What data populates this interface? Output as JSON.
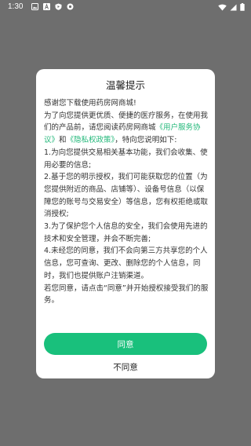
{
  "status_bar": {
    "time": "1:30",
    "left_icons": [
      "image-icon",
      "font-icon",
      "play-protect-icon",
      "shield-icon"
    ],
    "right_icons": [
      "wifi-icon",
      "signal-icon",
      "battery-icon"
    ]
  },
  "dialog": {
    "title": "温馨提示",
    "greeting": "感谢您下载使用药房网商城!",
    "intro_part1": "为了向您提供更优质、便捷的医疗服务，在使用我们的产品前，请您阅读药房网商城",
    "user_agreement_link": "《用户服务协议》",
    "and": "和",
    "privacy_policy_link": "《隐私权政策》",
    "intro_part2": "，特向您说明如下:",
    "item1": "1.为向您提供交易相关基本功能，我们会收集、使用必要的信息;",
    "item2": "2.基于您的明示授权，我们可能获取您的位置（为您提供附近的商品、店铺等）、设备号信息（以保障您的账号与交易安全）等信息，您有权拒绝或取消授权;",
    "item3": "3.为了保护您个人信息的安全，我们会使用先进的技术和安全管理，并会不断完善;",
    "item4": "4.未经您的同意，我们不会向第三方共享您的个人信息，您可查询、更改、删除您的个人信息，同时，我们也提供账户注销渠道。",
    "closing": "若您同意，请点击“同意”并开始授权接受我们的服务。",
    "agree_label": "同意",
    "disagree_label": "不同意"
  },
  "colors": {
    "overlay": "#6e6e6e",
    "accent": "#19c07c",
    "link": "#23b87a"
  }
}
